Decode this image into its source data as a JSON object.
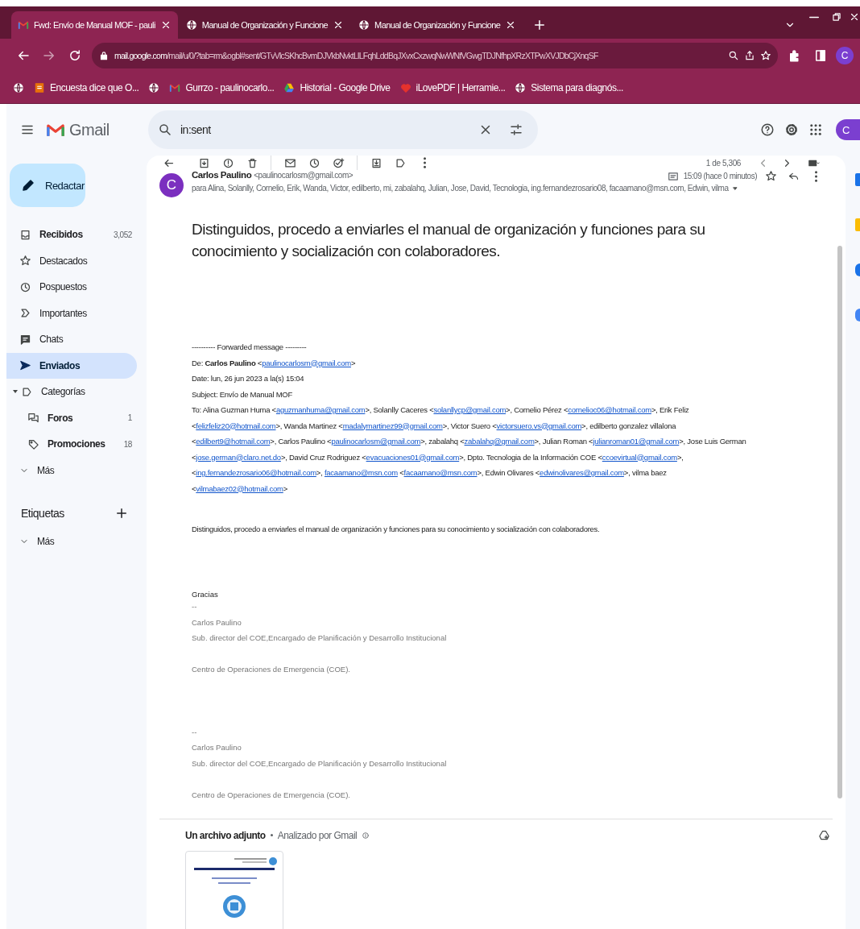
{
  "browser": {
    "tabs": [
      {
        "title": "Fwd: Envío de Manual MOF - pauli",
        "kind": "gmail",
        "selected": true
      },
      {
        "title": "Manual de Organización y Funcione",
        "kind": "globe",
        "selected": false
      },
      {
        "title": "Manual de Organización y Funcione",
        "kind": "globe",
        "selected": false
      }
    ],
    "address": {
      "domain": "mail.google.com",
      "path": "/mail/u/0/?tab=rm&ogbl#sent/GTvVlcSKhcBvmDJVkbNvktLlLFqhLddBqJXvxCxzwqNwWNfVGwgTDJNfhpXRzXTPwXVJDbCjXnqSF"
    },
    "profile_initial": "C",
    "bookmarks": [
      {
        "kind": "globe"
      },
      {
        "kind": "form",
        "label": "Encuesta dice que O..."
      },
      {
        "kind": "globe"
      },
      {
        "kind": "gmail",
        "label": "Gurrzo - paulinocarlo..."
      },
      {
        "kind": "drive",
        "label": "Historial - Google Drive"
      },
      {
        "kind": "heart",
        "label": "iLovePDF | Herramie..."
      },
      {
        "kind": "globe",
        "label": "Sistema para diagnós..."
      }
    ]
  },
  "gmail": {
    "logo": "Gmail",
    "search": {
      "value": "in:sent"
    },
    "account_initial": "C",
    "compose": "Redactar",
    "nav": [
      {
        "label": "Recibidos",
        "kind": "inbox",
        "count": "3,052",
        "unread": true,
        "selected": false
      },
      {
        "label": "Destacados",
        "kind": "star",
        "unread": false,
        "selected": false
      },
      {
        "label": "Pospuestos",
        "kind": "clock",
        "unread": false,
        "selected": false
      },
      {
        "label": "Importantes",
        "kind": "important",
        "unread": false,
        "selected": false
      },
      {
        "label": "Chats",
        "kind": "chat",
        "unread": false,
        "selected": false
      },
      {
        "label": "Enviados",
        "kind": "send",
        "unread": true,
        "selected": true
      },
      {
        "label": "Categorías",
        "kind": "label",
        "unread": false,
        "selected": false,
        "expanded": true,
        "children": [
          {
            "label": "Foros",
            "kind": "forum",
            "count": "1",
            "unread": true,
            "selected": false
          },
          {
            "label": "Promociones",
            "kind": "tag",
            "count": "18",
            "unread": true,
            "selected": false
          }
        ]
      },
      {
        "label": "Más",
        "kind": "chevron",
        "unread": false,
        "selected": false
      }
    ],
    "labels_heading": "Etiquetas",
    "labels_more": "Más",
    "counter": "1 de 5,306",
    "message": {
      "avatar": "C",
      "sender_name": "Carlos Paulino",
      "sender_email": "<paulinocarlosm@gmail.com>",
      "recipients": "para Alina, Solanlly, Cornelio, Erik, Wanda, Victor, edilberto, mi, zabalahq, Julian, Jose, David, Tecnologia, ing.fernandezrosario08, facaamano@msn.com, Edwin, vilma",
      "time": "15:09 (hace 0 minutos)",
      "headline": "Distinguidos,  procedo  a enviarles el manual de organización y funciones  para su conocimiento y socialización con colaboradores.",
      "forwarded": {
        "separator": "---------- Forwarded message ---------",
        "from": [
          {
            "kind": "text",
            "text": "De: **Carlos Paulino** <"
          },
          {
            "kind": "link",
            "text": "paulinocarlosm@gmail.com"
          },
          {
            "kind": "text",
            "text": ">"
          }
        ],
        "date": "Date: lun, 26 jun 2023 a la(s) 15:04",
        "subject": "Subject: Envío de Manual MOF",
        "to": [
          {
            "kind": "text",
            "text": "To: Alina Guzman Huma <"
          },
          {
            "kind": "link",
            "text": "aguzmanhuma@gmail.com"
          },
          {
            "kind": "text",
            "text": ">, Solanlly Caceres <"
          },
          {
            "kind": "link",
            "text": "solanllycp@gmail.com"
          },
          {
            "kind": "text",
            "text": ">, Cornelio Pérez <"
          },
          {
            "kind": "link",
            "text": "cornelioc06@hotmail.com"
          },
          {
            "kind": "text",
            "text": ">, Erik Feliz <"
          },
          {
            "kind": "link",
            "text": "felizfeliz20@hotmail.com"
          },
          {
            "kind": "text",
            "text": ">, Wanda Martinez <"
          },
          {
            "kind": "link",
            "text": "madalymartinez99@gmail.com"
          },
          {
            "kind": "text",
            "text": ">, Victor Suero <"
          },
          {
            "kind": "link",
            "text": "victorsuero.vs@gmail.com"
          },
          {
            "kind": "text",
            "text": ">, edilberto gonzalez villalona <"
          },
          {
            "kind": "link",
            "text": "edilbert9@hotmail.com"
          },
          {
            "kind": "text",
            "text": ">, Carlos Paulino <"
          },
          {
            "kind": "link",
            "text": "paulinocarlosm@gmail.com"
          },
          {
            "kind": "text",
            "text": ">, zabalahq <"
          },
          {
            "kind": "link",
            "text": "zabalahq@gmail.com"
          },
          {
            "kind": "text",
            "text": ">, Julian Roman <"
          },
          {
            "kind": "link",
            "text": "julianroman01@gmail.com"
          },
          {
            "kind": "text",
            "text": ">, Jose Luis German <"
          },
          {
            "kind": "link",
            "text": "jose.german@claro.net.do"
          },
          {
            "kind": "text",
            "text": ">, David Cruz Rodriguez <"
          },
          {
            "kind": "link",
            "text": "evacuaciones01@gmail.com"
          },
          {
            "kind": "text",
            "text": ">, Dpto. Tecnologia de la Información COE <"
          },
          {
            "kind": "link",
            "text": "ccoevirtual@gmail.com"
          },
          {
            "kind": "text",
            "text": ">, <"
          },
          {
            "kind": "link",
            "text": "ing.fernandezrosario06@hotmail.com"
          },
          {
            "kind": "text",
            "text": ">, "
          },
          {
            "kind": "link",
            "text": "facaamano@msn.com"
          },
          {
            "kind": "text",
            "text": " <"
          },
          {
            "kind": "link",
            "text": "facaamano@msn.com"
          },
          {
            "kind": "text",
            "text": ">, Edwin Olivares <"
          },
          {
            "kind": "link",
            "text": "edwinolivares@gmail.com"
          },
          {
            "kind": "text",
            "text": ">, vilma baez <"
          },
          {
            "kind": "link",
            "text": "vilmabaez02@hotmail.com"
          },
          {
            "kind": "text",
            "text": ">"
          }
        ]
      },
      "body": "Distinguidos,  procedo  a enviarles el manual de organización y funciones  para su conocimiento y socialización con colaboradores.",
      "closing": "Gracias",
      "signatures": [
        {
          "dash": "--",
          "name": "Carlos Paulino",
          "title": "Sub. director del COE,Encargado de Planificación y Desarrollo Institucional",
          "org": "Centro de Operaciones de Emergencia (COE)."
        },
        {
          "dash": "--",
          "name": "Carlos Paulino",
          "title": "Sub. director del COE,Encargado de Planificación y Desarrollo Institucional",
          "org": "Centro de Operaciones de Emergencia (COE)."
        }
      ],
      "attachment": {
        "heading": "Un archivo adjunto",
        "scanned": "Analizado por Gmail"
      }
    }
  }
}
